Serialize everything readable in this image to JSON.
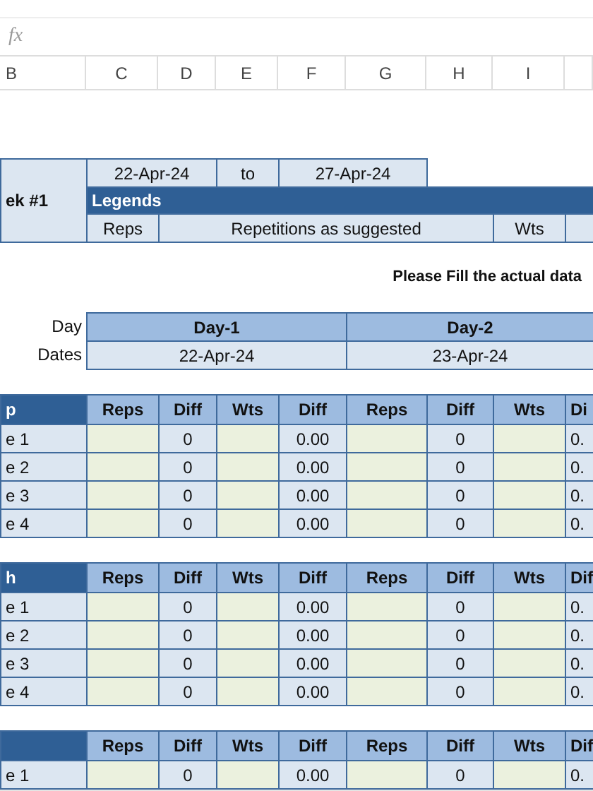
{
  "formula_bar": {
    "fx": "fx"
  },
  "column_headers": [
    "B",
    "C",
    "D",
    "E",
    "F",
    "G",
    "H",
    "I"
  ],
  "week": {
    "label": "ek #1",
    "start": "22-Apr-24",
    "to": "to",
    "end": "27-Apr-24"
  },
  "legends": {
    "title": "Legends",
    "reps_key": "Reps",
    "reps_text": "Repetitions as suggested",
    "wts_key": "Wts"
  },
  "notice": "Please Fill the actual data",
  "days": {
    "day_label": "Day",
    "dates_label": "Dates",
    "items": [
      {
        "day": "Day-1",
        "date": "22-Apr-24"
      },
      {
        "day": "Day-2",
        "date": "23-Apr-24"
      }
    ]
  },
  "sections": [
    {
      "title": "p",
      "columns": [
        "Reps",
        "Diff",
        "Wts",
        "Diff",
        "Reps",
        "Diff",
        "Wts",
        "Di"
      ],
      "rows": [
        {
          "label": "e 1",
          "values": [
            "0",
            "0.00",
            "0",
            "0."
          ]
        },
        {
          "label": "e 2",
          "values": [
            "0",
            "0.00",
            "0",
            "0."
          ]
        },
        {
          "label": "e 3",
          "values": [
            "0",
            "0.00",
            "0",
            "0."
          ]
        },
        {
          "label": "e 4",
          "values": [
            "0",
            "0.00",
            "0",
            "0."
          ]
        }
      ]
    },
    {
      "title": "h",
      "columns": [
        "Reps",
        "Diff",
        "Wts",
        "Diff",
        "Reps",
        "Diff",
        "Wts",
        "Dif"
      ],
      "rows": [
        {
          "label": "e 1",
          "values": [
            "0",
            "0.00",
            "0",
            "0."
          ]
        },
        {
          "label": "e 2",
          "values": [
            "0",
            "0.00",
            "0",
            "0."
          ]
        },
        {
          "label": "e 3",
          "values": [
            "0",
            "0.00",
            "0",
            "0."
          ]
        },
        {
          "label": "e 4",
          "values": [
            "0",
            "0.00",
            "0",
            "0."
          ]
        }
      ]
    },
    {
      "columns": [
        "Reps",
        "Diff",
        "Wts",
        "Diff",
        "Reps",
        "Diff",
        "Wts",
        "Dif"
      ],
      "rows": [
        {
          "label": "e 1",
          "values": [
            "0",
            "0.00",
            "0",
            "0."
          ]
        }
      ]
    }
  ]
}
